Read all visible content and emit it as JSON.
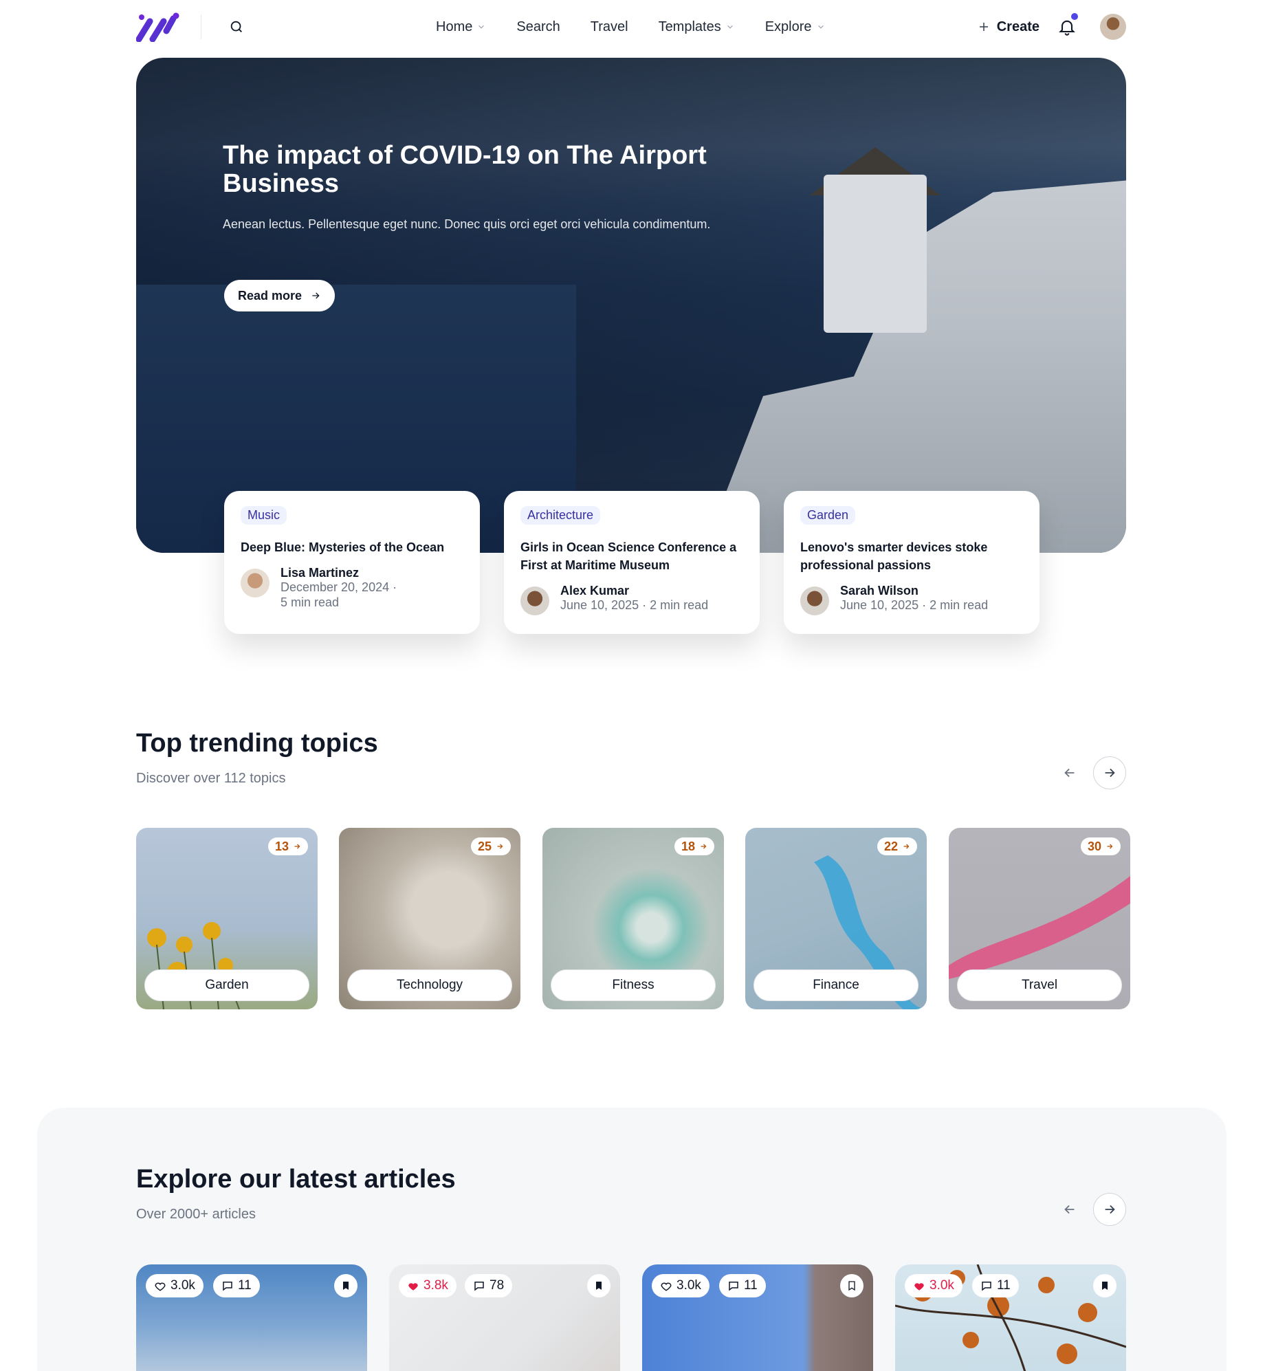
{
  "header": {
    "logo_name": "brand-logo",
    "nav": [
      {
        "label": "Home",
        "has_dropdown": true
      },
      {
        "label": "Search",
        "has_dropdown": false
      },
      {
        "label": "Travel",
        "has_dropdown": false
      },
      {
        "label": "Templates",
        "has_dropdown": true
      },
      {
        "label": "Explore",
        "has_dropdown": true
      }
    ],
    "create_label": "Create",
    "accent_color": "#4f46e5"
  },
  "hero": {
    "title": "The impact of COVID-19 on The Airport Business",
    "description": "Aenean lectus. Pellentesque eget nunc. Donec quis orci eget orci vehicula condimentum.",
    "read_more_label": "Read more",
    "cards": [
      {
        "category": "Music",
        "title": "Deep Blue: Mysteries of the Ocean",
        "author": "Lisa Martinez",
        "date_line1": "December 20, 2024 ·",
        "date_line2": "5 min read"
      },
      {
        "category": "Architecture",
        "title": "Girls in Ocean Science Conference a First at Maritime Museum",
        "author": "Alex Kumar",
        "date_line1": "June 10, 2025 · 2 min read"
      },
      {
        "category": "Garden",
        "title": "Lenovo's smarter devices stoke professional passions",
        "author": "Sarah Wilson",
        "date_line1": "June 10, 2025 · 2 min read"
      }
    ]
  },
  "trending": {
    "title": "Top trending topics",
    "subtitle": "Discover over 112 topics",
    "topics": [
      {
        "name": "Garden",
        "count": "13"
      },
      {
        "name": "Technology",
        "count": "25"
      },
      {
        "name": "Fitness",
        "count": "18"
      },
      {
        "name": "Finance",
        "count": "22"
      },
      {
        "name": "Travel",
        "count": "30"
      }
    ]
  },
  "latest": {
    "title": "Explore our latest articles",
    "subtitle": "Over 2000+ articles",
    "articles": [
      {
        "likes": "3.0k",
        "liked": false,
        "comments": "11"
      },
      {
        "likes": "3.8k",
        "liked": true,
        "comments": "78"
      },
      {
        "likes": "3.0k",
        "liked": false,
        "comments": "11"
      },
      {
        "likes": "3.0k",
        "liked": true,
        "comments": "11"
      }
    ]
  }
}
